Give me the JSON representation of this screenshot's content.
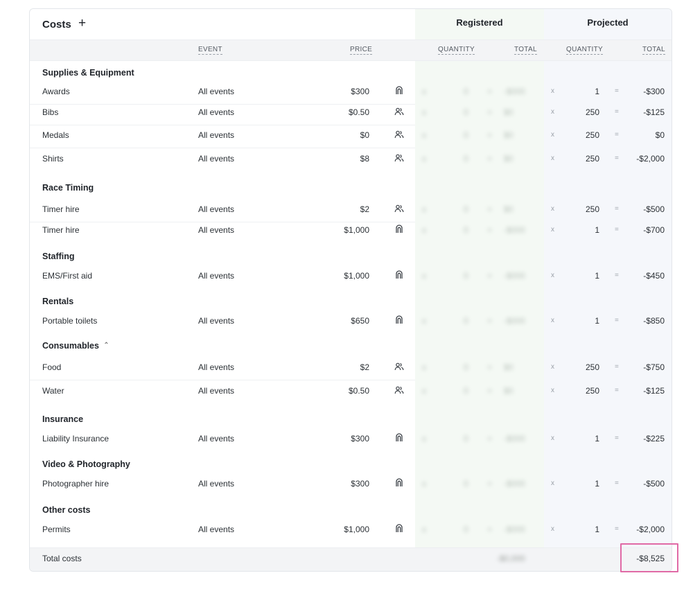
{
  "header": {
    "title": "Costs",
    "add_label": "+",
    "registered_label": "Registered",
    "projected_label": "Projected"
  },
  "columns": {
    "event": "EVENT",
    "price": "PRICE",
    "reg_quantity": "QUANTITY",
    "reg_total": "TOTAL",
    "proj_quantity": "QUANTITY",
    "proj_total": "TOTAL"
  },
  "symbols": {
    "times": "x",
    "equals": "="
  },
  "sections": [
    {
      "title": "Supplies & Equipment",
      "collapse_icon": "",
      "rows": [
        {
          "name": "Awards",
          "event": "All events",
          "price": "$300",
          "icon": "flat-fee-icon",
          "qty": "1",
          "total": "-$300"
        },
        {
          "name": "Bibs",
          "event": "All events",
          "price": "$0.50",
          "icon": "per-participant-icon",
          "qty": "250",
          "total": "-$125"
        },
        {
          "name": "Medals",
          "event": "All events",
          "price": "$0",
          "icon": "per-participant-icon",
          "qty": "250",
          "total": "$0"
        },
        {
          "name": "Shirts",
          "event": "All events",
          "price": "$8",
          "icon": "per-participant-icon",
          "qty": "250",
          "total": "-$2,000"
        }
      ]
    },
    {
      "title": "Race Timing",
      "rows": [
        {
          "name": "Timer hire",
          "event": "All events",
          "price": "$2",
          "icon": "per-participant-icon",
          "qty": "250",
          "total": "-$500"
        },
        {
          "name": "Timer hire",
          "event": "All events",
          "price": "$1,000",
          "icon": "flat-fee-icon",
          "qty": "1",
          "total": "-$700"
        }
      ]
    },
    {
      "title": "Staffing",
      "rows": [
        {
          "name": "EMS/First aid",
          "event": "All events",
          "price": "$1,000",
          "icon": "flat-fee-icon",
          "qty": "1",
          "total": "-$450"
        }
      ]
    },
    {
      "title": "Rentals",
      "rows": [
        {
          "name": "Portable toilets",
          "event": "All events",
          "price": "$650",
          "icon": "flat-fee-icon",
          "qty": "1",
          "total": "-$850"
        }
      ]
    },
    {
      "title": "Consumables",
      "collapse_icon": "chevron-up-icon",
      "rows": [
        {
          "name": "Food",
          "event": "All events",
          "price": "$2",
          "icon": "per-participant-icon",
          "qty": "250",
          "total": "-$750"
        },
        {
          "name": "Water",
          "event": "All events",
          "price": "$0.50",
          "icon": "per-participant-icon",
          "qty": "250",
          "total": "-$125"
        }
      ]
    },
    {
      "title": "Insurance",
      "rows": [
        {
          "name": "Liability Insurance",
          "event": "All events",
          "price": "$300",
          "icon": "flat-fee-icon",
          "qty": "1",
          "total": "-$225"
        }
      ]
    },
    {
      "title": "Video & Photography",
      "rows": [
        {
          "name": "Photographer hire",
          "event": "All events",
          "price": "$300",
          "icon": "flat-fee-icon",
          "qty": "1",
          "total": "-$500"
        }
      ]
    },
    {
      "title": "Other costs",
      "rows": [
        {
          "name": "Permits",
          "event": "All events",
          "price": "$1,000",
          "icon": "flat-fee-icon",
          "qty": "1",
          "total": "-$2,000"
        }
      ]
    }
  ],
  "footer": {
    "label": "Total costs",
    "projected_total": "-$8,525"
  },
  "colors": {
    "registered_bg": "#f4f9f4",
    "projected_bg": "#f5f7fb",
    "highlight": "#e06aa6"
  }
}
